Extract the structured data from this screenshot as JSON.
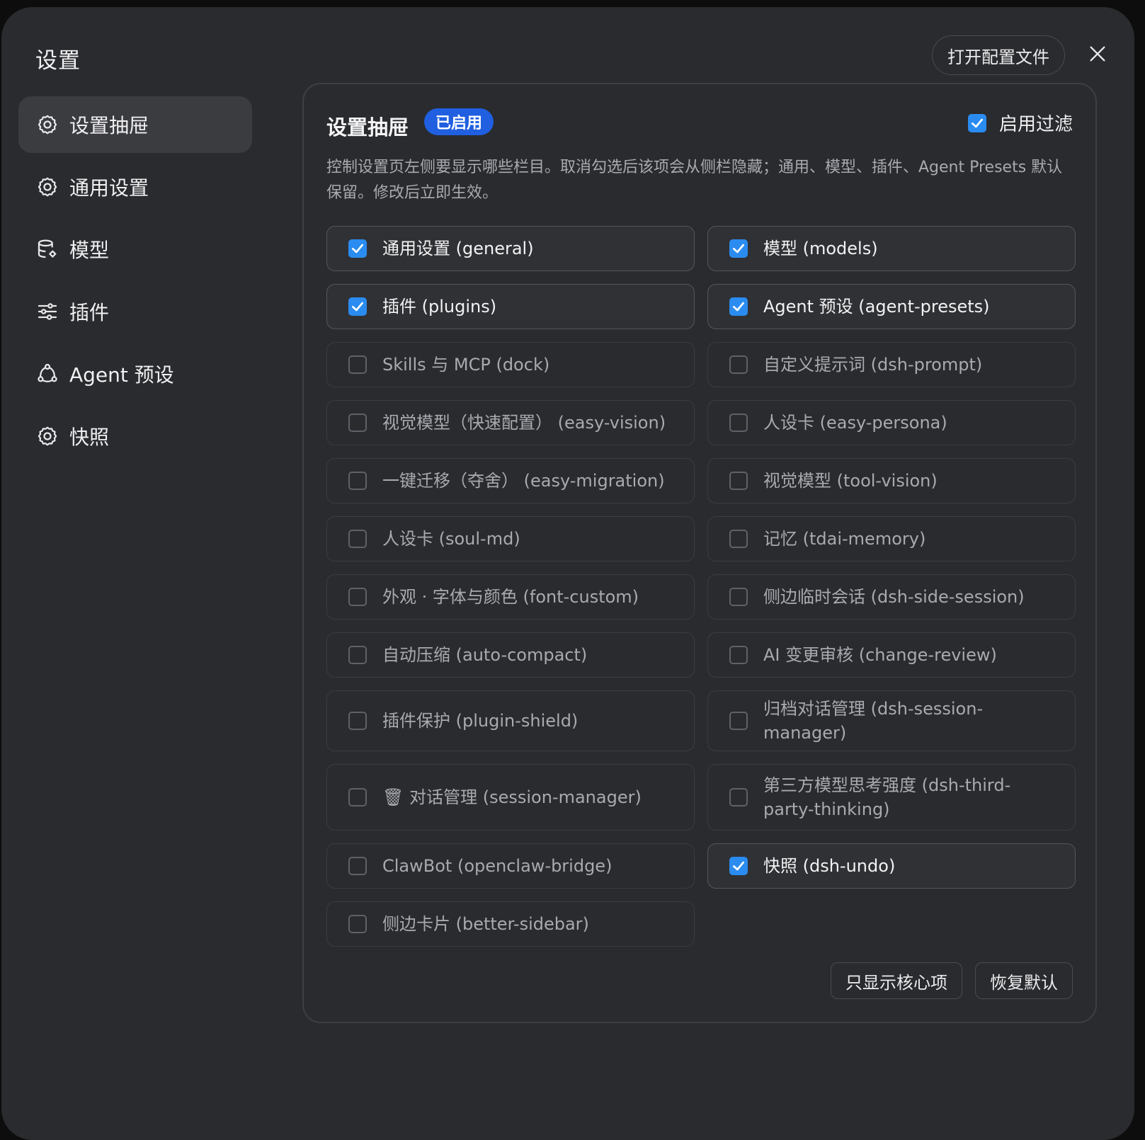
{
  "dialog": {
    "title": "设置",
    "open_config_label": "打开配置文件"
  },
  "sidebar": {
    "items": [
      {
        "label": "设置抽屉",
        "icon": "gear-icon",
        "active": true
      },
      {
        "label": "通用设置",
        "icon": "gear-icon",
        "active": false
      },
      {
        "label": "模型",
        "icon": "database-gear-icon",
        "active": false
      },
      {
        "label": "插件",
        "icon": "sliders-icon",
        "active": false
      },
      {
        "label": "Agent 预设",
        "icon": "agent-cycle-icon",
        "active": false
      },
      {
        "label": "快照",
        "icon": "gear-icon",
        "active": false
      }
    ]
  },
  "panel": {
    "title": "设置抽屉",
    "badge": "已启用",
    "filter_label": "启用过滤",
    "filter_checked": true,
    "description": "控制设置页左侧要显示哪些栏目。取消勾选后该项会从侧栏隐藏；通用、模型、插件、Agent Presets 默认保留。修改后立即生效。",
    "options": [
      {
        "label": "通用设置 (general)",
        "checked": true
      },
      {
        "label": "模型 (models)",
        "checked": true
      },
      {
        "label": "插件 (plugins)",
        "checked": true
      },
      {
        "label": "Agent 预设 (agent-presets)",
        "checked": true
      },
      {
        "label": "Skills 与 MCP (dock)",
        "checked": false
      },
      {
        "label": "自定义提示词 (dsh-prompt)",
        "checked": false
      },
      {
        "label": "视觉模型（快速配置） (easy-vision)",
        "checked": false
      },
      {
        "label": "人设卡 (easy-persona)",
        "checked": false
      },
      {
        "label": "一键迁移（夺舍） (easy-migration)",
        "checked": false
      },
      {
        "label": "视觉模型 (tool-vision)",
        "checked": false
      },
      {
        "label": "人设卡 (soul-md)",
        "checked": false
      },
      {
        "label": "记忆 (tdai-memory)",
        "checked": false
      },
      {
        "label": "外观 · 字体与颜色 (font-custom)",
        "checked": false
      },
      {
        "label": "侧边临时会话 (dsh-side-session)",
        "checked": false
      },
      {
        "label": "自动压缩 (auto-compact)",
        "checked": false
      },
      {
        "label": "AI 变更审核 (change-review)",
        "checked": false
      },
      {
        "label": "插件保护 (plugin-shield)",
        "checked": false
      },
      {
        "label": "归档对话管理 (dsh-session-manager)",
        "checked": false
      },
      {
        "label": "🗑 对话管理 (session-manager)",
        "checked": false
      },
      {
        "label": "第三方模型思考强度 (dsh-third-party-thinking)",
        "checked": false
      },
      {
        "label": "ClawBot (openclaw-bridge)",
        "checked": false
      },
      {
        "label": "快照 (dsh-undo)",
        "checked": true
      },
      {
        "label": "侧边卡片 (better-sidebar)",
        "checked": false
      }
    ],
    "core_only_label": "只显示核心项",
    "reset_label": "恢复默认"
  }
}
